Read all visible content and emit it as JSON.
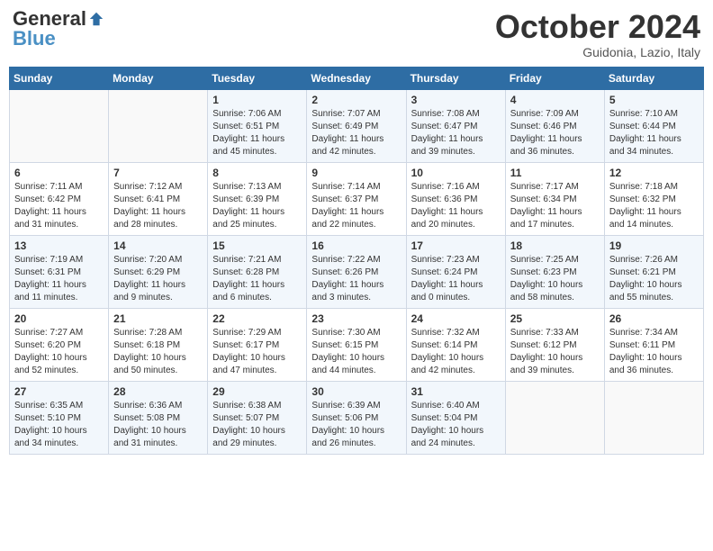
{
  "header": {
    "logo_general": "General",
    "logo_blue": "Blue",
    "month": "October 2024",
    "location": "Guidonia, Lazio, Italy"
  },
  "days_of_week": [
    "Sunday",
    "Monday",
    "Tuesday",
    "Wednesday",
    "Thursday",
    "Friday",
    "Saturday"
  ],
  "weeks": [
    [
      {
        "num": "",
        "info": ""
      },
      {
        "num": "",
        "info": ""
      },
      {
        "num": "1",
        "info": "Sunrise: 7:06 AM\nSunset: 6:51 PM\nDaylight: 11 hours and 45 minutes."
      },
      {
        "num": "2",
        "info": "Sunrise: 7:07 AM\nSunset: 6:49 PM\nDaylight: 11 hours and 42 minutes."
      },
      {
        "num": "3",
        "info": "Sunrise: 7:08 AM\nSunset: 6:47 PM\nDaylight: 11 hours and 39 minutes."
      },
      {
        "num": "4",
        "info": "Sunrise: 7:09 AM\nSunset: 6:46 PM\nDaylight: 11 hours and 36 minutes."
      },
      {
        "num": "5",
        "info": "Sunrise: 7:10 AM\nSunset: 6:44 PM\nDaylight: 11 hours and 34 minutes."
      }
    ],
    [
      {
        "num": "6",
        "info": "Sunrise: 7:11 AM\nSunset: 6:42 PM\nDaylight: 11 hours and 31 minutes."
      },
      {
        "num": "7",
        "info": "Sunrise: 7:12 AM\nSunset: 6:41 PM\nDaylight: 11 hours and 28 minutes."
      },
      {
        "num": "8",
        "info": "Sunrise: 7:13 AM\nSunset: 6:39 PM\nDaylight: 11 hours and 25 minutes."
      },
      {
        "num": "9",
        "info": "Sunrise: 7:14 AM\nSunset: 6:37 PM\nDaylight: 11 hours and 22 minutes."
      },
      {
        "num": "10",
        "info": "Sunrise: 7:16 AM\nSunset: 6:36 PM\nDaylight: 11 hours and 20 minutes."
      },
      {
        "num": "11",
        "info": "Sunrise: 7:17 AM\nSunset: 6:34 PM\nDaylight: 11 hours and 17 minutes."
      },
      {
        "num": "12",
        "info": "Sunrise: 7:18 AM\nSunset: 6:32 PM\nDaylight: 11 hours and 14 minutes."
      }
    ],
    [
      {
        "num": "13",
        "info": "Sunrise: 7:19 AM\nSunset: 6:31 PM\nDaylight: 11 hours and 11 minutes."
      },
      {
        "num": "14",
        "info": "Sunrise: 7:20 AM\nSunset: 6:29 PM\nDaylight: 11 hours and 9 minutes."
      },
      {
        "num": "15",
        "info": "Sunrise: 7:21 AM\nSunset: 6:28 PM\nDaylight: 11 hours and 6 minutes."
      },
      {
        "num": "16",
        "info": "Sunrise: 7:22 AM\nSunset: 6:26 PM\nDaylight: 11 hours and 3 minutes."
      },
      {
        "num": "17",
        "info": "Sunrise: 7:23 AM\nSunset: 6:24 PM\nDaylight: 11 hours and 0 minutes."
      },
      {
        "num": "18",
        "info": "Sunrise: 7:25 AM\nSunset: 6:23 PM\nDaylight: 10 hours and 58 minutes."
      },
      {
        "num": "19",
        "info": "Sunrise: 7:26 AM\nSunset: 6:21 PM\nDaylight: 10 hours and 55 minutes."
      }
    ],
    [
      {
        "num": "20",
        "info": "Sunrise: 7:27 AM\nSunset: 6:20 PM\nDaylight: 10 hours and 52 minutes."
      },
      {
        "num": "21",
        "info": "Sunrise: 7:28 AM\nSunset: 6:18 PM\nDaylight: 10 hours and 50 minutes."
      },
      {
        "num": "22",
        "info": "Sunrise: 7:29 AM\nSunset: 6:17 PM\nDaylight: 10 hours and 47 minutes."
      },
      {
        "num": "23",
        "info": "Sunrise: 7:30 AM\nSunset: 6:15 PM\nDaylight: 10 hours and 44 minutes."
      },
      {
        "num": "24",
        "info": "Sunrise: 7:32 AM\nSunset: 6:14 PM\nDaylight: 10 hours and 42 minutes."
      },
      {
        "num": "25",
        "info": "Sunrise: 7:33 AM\nSunset: 6:12 PM\nDaylight: 10 hours and 39 minutes."
      },
      {
        "num": "26",
        "info": "Sunrise: 7:34 AM\nSunset: 6:11 PM\nDaylight: 10 hours and 36 minutes."
      }
    ],
    [
      {
        "num": "27",
        "info": "Sunrise: 6:35 AM\nSunset: 5:10 PM\nDaylight: 10 hours and 34 minutes."
      },
      {
        "num": "28",
        "info": "Sunrise: 6:36 AM\nSunset: 5:08 PM\nDaylight: 10 hours and 31 minutes."
      },
      {
        "num": "29",
        "info": "Sunrise: 6:38 AM\nSunset: 5:07 PM\nDaylight: 10 hours and 29 minutes."
      },
      {
        "num": "30",
        "info": "Sunrise: 6:39 AM\nSunset: 5:06 PM\nDaylight: 10 hours and 26 minutes."
      },
      {
        "num": "31",
        "info": "Sunrise: 6:40 AM\nSunset: 5:04 PM\nDaylight: 10 hours and 24 minutes."
      },
      {
        "num": "",
        "info": ""
      },
      {
        "num": "",
        "info": ""
      }
    ]
  ]
}
